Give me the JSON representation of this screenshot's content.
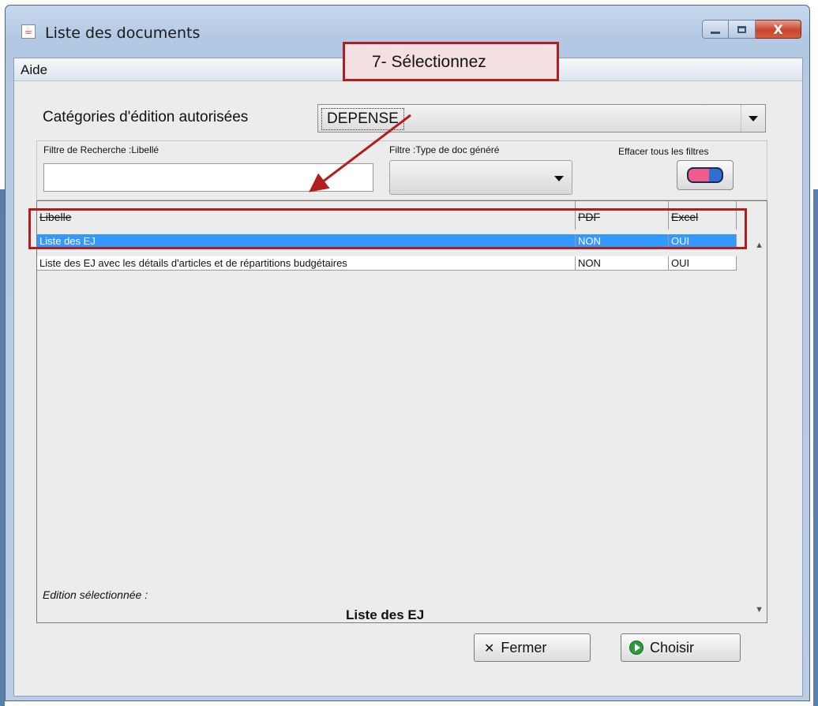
{
  "window": {
    "title": "Liste des documents",
    "close_glyph": "X",
    "accent_color": "#3399ff"
  },
  "menu": {
    "items": [
      {
        "label": "Aide"
      }
    ]
  },
  "categories": {
    "label": "Catégories d'édition autorisées",
    "selected": "DEPENSE"
  },
  "filters": {
    "search_label": "Filtre de Recherche :Libellé",
    "search_value": "",
    "type_label": "Filtre :Type de doc généré",
    "type_value": "",
    "clear_label": "Effacer tous les filtres"
  },
  "table": {
    "columns": [
      "Libelle",
      "PDF",
      "Excel"
    ],
    "rows": [
      {
        "libelle": "Liste des EJ",
        "pdf": "NON",
        "excel": "OUI",
        "selected": true
      },
      {
        "libelle": "Liste des EJ avec les détails d'articles et de répartitions budgétaires",
        "pdf": "NON",
        "excel": "OUI",
        "selected": false
      }
    ]
  },
  "edition": {
    "label": "Edition sélectionnée :",
    "value": "Liste des EJ"
  },
  "buttons": {
    "close_label": "Fermer",
    "choose_label": "Choisir"
  },
  "annotation": {
    "step_text": "7-   Sélectionnez",
    "color": "#b01e1e"
  }
}
